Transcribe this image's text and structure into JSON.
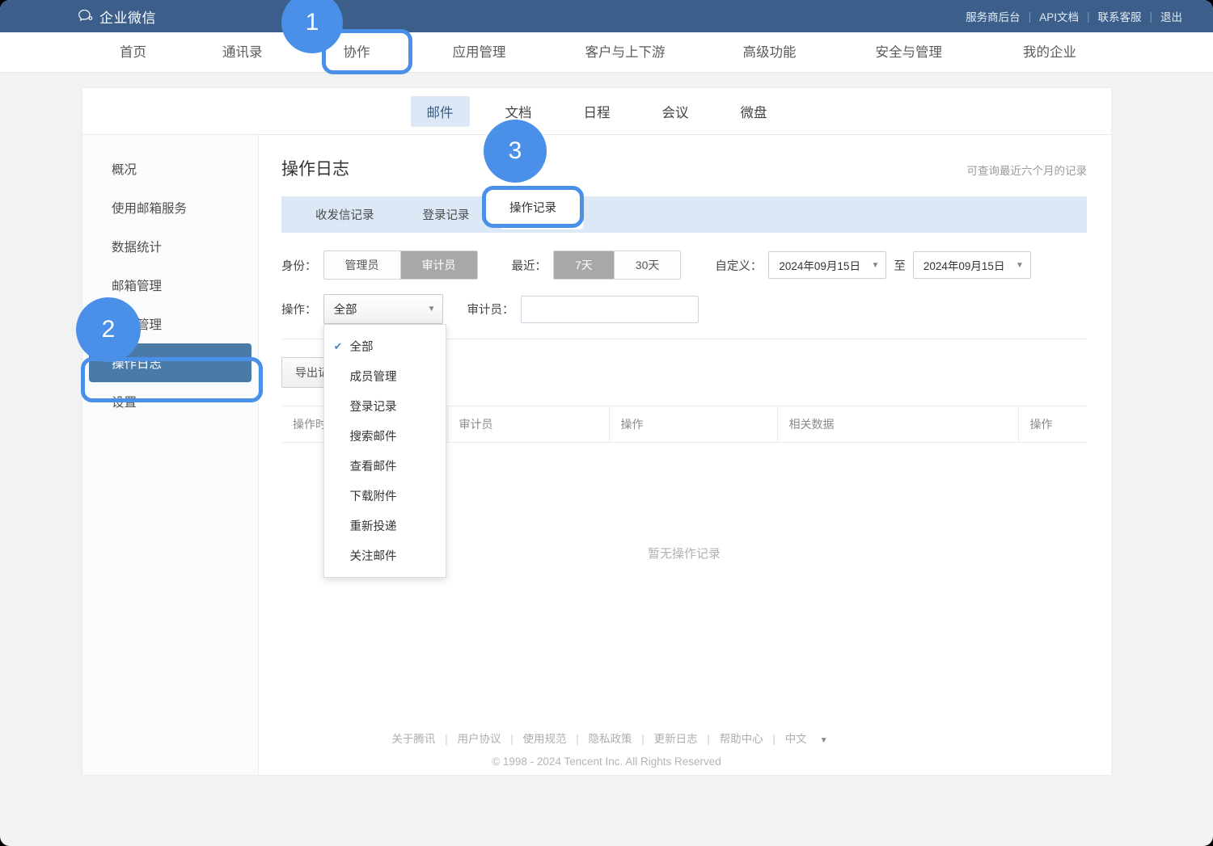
{
  "topbar": {
    "brand": "企业微信",
    "brand_icon": "chat-bubble-icon",
    "links": [
      "服务商后台",
      "API文档",
      "联系客服",
      "退出"
    ]
  },
  "mainnav": {
    "items": [
      {
        "label": "首页"
      },
      {
        "label": "通讯录"
      },
      {
        "label": "协作"
      },
      {
        "label": "应用管理"
      },
      {
        "label": "客户与上下游"
      },
      {
        "label": "高级功能"
      },
      {
        "label": "安全与管理"
      },
      {
        "label": "我的企业"
      }
    ],
    "active_index": 2
  },
  "subtabs": {
    "items": [
      "邮件",
      "文档",
      "日程",
      "会议",
      "微盘"
    ],
    "active_index": 0
  },
  "sidebar": {
    "items": [
      "概况",
      "使用邮箱服务",
      "数据统计",
      "邮箱管理",
      "安全管理",
      "操作日志",
      "设置"
    ],
    "active_index": 5
  },
  "content": {
    "page_title": "操作日志",
    "head_note": "可查询最近六个月的记录",
    "record_tabs": [
      "收发信记录",
      "登录记录",
      "操作记录"
    ],
    "record_tabs_active_index": 2,
    "empty_text": "暂无操作记录",
    "export_label": "导出记录"
  },
  "filters": {
    "identity_label": "身份：",
    "identity_options": [
      "管理员",
      "审计员"
    ],
    "identity_selected": "审计员",
    "recent_label": "最近：",
    "recent_options": [
      "7天",
      "30天"
    ],
    "recent_selected": "7天",
    "custom_label": "自定义：",
    "date_from": "2024年09月15日",
    "date_to": "2024年09月15日",
    "date_sep": "至",
    "action_label": "操作：",
    "action_value": "全部",
    "auditor_label": "审计员：",
    "auditor_value": "",
    "auditor_placeholder": ""
  },
  "dropdown": {
    "options": [
      "全部",
      "成员管理",
      "登录记录",
      "搜索邮件",
      "查看邮件",
      "下载附件",
      "重新投递",
      "关注邮件"
    ],
    "selected": "全部",
    "check_icon": "check-icon"
  },
  "table": {
    "columns": [
      "操作时间",
      "审计员",
      "操作",
      "相关数据",
      "操作"
    ]
  },
  "footer": {
    "links": [
      "关于腾讯",
      "用户协议",
      "使用规范",
      "隐私政策",
      "更新日志",
      "帮助中心",
      "中文"
    ],
    "lang_caret": "chevron-down-icon",
    "copyright": "© 1998 - 2024 Tencent Inc. All Rights Reserved"
  },
  "annotations": {
    "step1": "1",
    "step2": "2",
    "step3": "3"
  },
  "colors": {
    "topbar": "#3b5f8a",
    "accent": "#4a90e8",
    "subtab_active_bg": "#dce8f5",
    "sidebar_active_bg": "#4a7ba8",
    "segment_on_bg": "#a8a8a8"
  }
}
